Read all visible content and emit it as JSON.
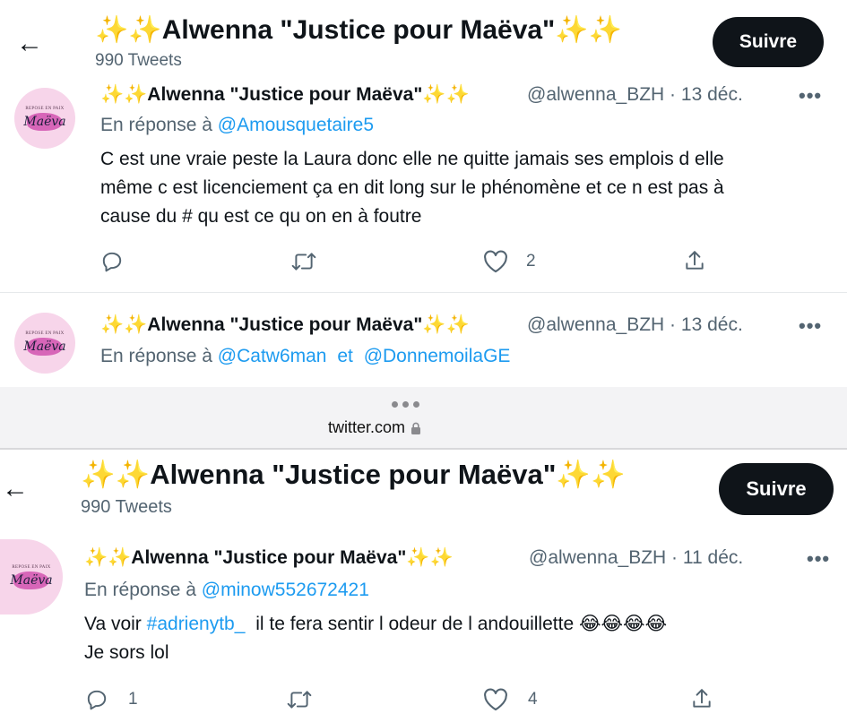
{
  "top": {
    "back_icon": "←",
    "profile_name": "✨✨Alwenna \"Justice pour Maëva\"✨✨",
    "tweet_count": "990 Tweets",
    "follow_label": "Suivre"
  },
  "tweets": [
    {
      "name": "✨✨Alwenna \"Justice pour Maëva\"✨✨",
      "meta": "@alwenna_BZH · 13 déc.",
      "reply_prefix": "En réponse à",
      "mention1": "@Amousquetaire5",
      "line1": "C est une vraie peste la Laura donc elle ne quitte jamais ses emplois d elle",
      "line2": "même c est licenciement ça en dit long sur le phénomène et ce n est pas à",
      "line3": "cause du # qu est ce qu on en à foutre",
      "likes": "2",
      "more": "•••"
    },
    {
      "name": "✨✨Alwenna \"Justice pour Maëva\"✨✨",
      "meta": "@alwenna_BZH · 13 déc.",
      "reply_prefix": "En réponse à",
      "mention1": "@Catw6man",
      "connector": "et",
      "mention2": "@DonnemoilaGE",
      "more": "•••"
    }
  ],
  "browser": {
    "domain": "twitter.com",
    "lock_icon": "lock-icon"
  },
  "bottom": {
    "back_icon": "←",
    "profile_name": "✨✨Alwenna \"Justice pour Maëva\"✨✨",
    "tweet_count": "990 Tweets",
    "follow_label": "Suivre",
    "tweet": {
      "name": "✨✨Alwenna \"Justice pour Maëva\"✨✨",
      "meta": "@alwenna_BZH · 11 déc.",
      "reply_prefix": "En réponse à",
      "mention1": "@minow552672421",
      "text_pre": "Va voir",
      "hashtag": "#adrienytb_",
      "text_post": "il te fera sentir l odeur de l andouillette 😂😂😂😂",
      "line2": "Je sors lol",
      "replies": "1",
      "likes": "4",
      "more": "•••"
    }
  },
  "avatar": {
    "top_text": "REPOSE EN PAIX",
    "script_text": "Maëva"
  },
  "colors": {
    "accent": "#1d9bf0",
    "text": "#0f1419",
    "secondary": "#536471",
    "avatar_bg": "#f7d5ea",
    "avatar_blob": "#d766b8"
  }
}
